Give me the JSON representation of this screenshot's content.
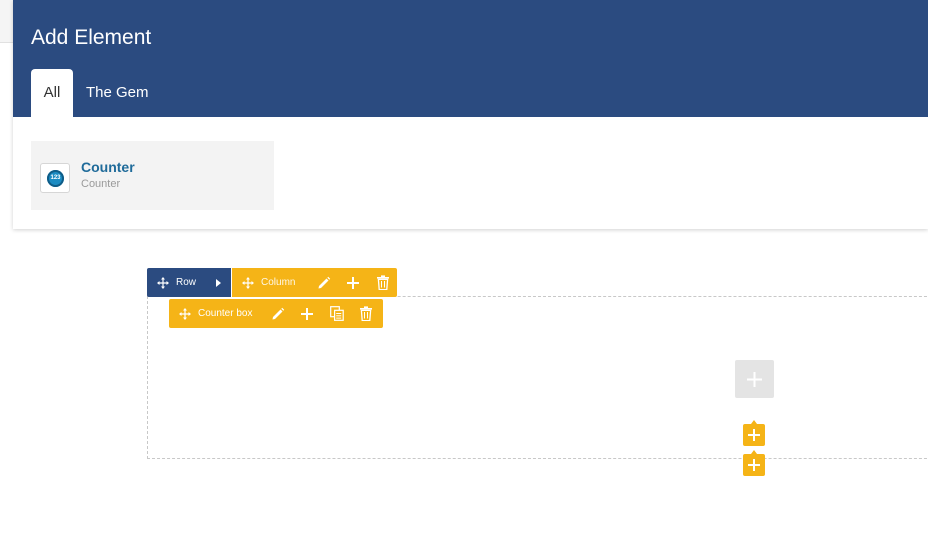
{
  "modal": {
    "title": "Add Element",
    "tabs": [
      {
        "label": "All",
        "active": true
      },
      {
        "label": "The Gem",
        "active": false
      }
    ],
    "elements": [
      {
        "name": "Counter",
        "description": "Counter",
        "icon": "counter-123-icon",
        "icon_text": "123"
      }
    ]
  },
  "builder": {
    "row_bar": {
      "label": "Row"
    },
    "column_bar": {
      "label": "Column"
    },
    "counter_box_bar": {
      "label": "Counter box"
    }
  },
  "colors": {
    "header_blue": "#2b4b80",
    "control_yellow": "#f5b417",
    "link_blue": "#1f6b9a"
  }
}
